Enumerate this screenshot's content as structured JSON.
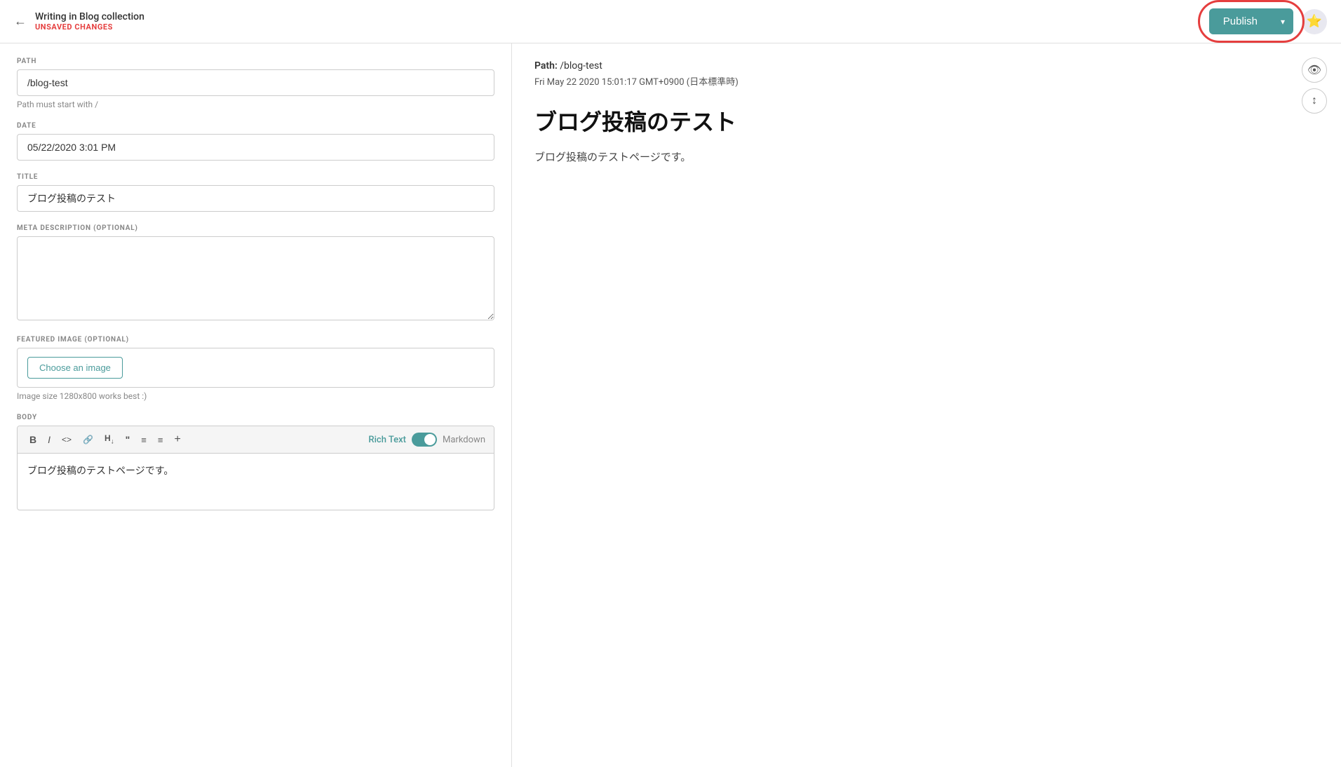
{
  "header": {
    "back_label": "←",
    "breadcrumb": "Writing in Blog collection",
    "unsaved_label": "UNSAVED CHANGES",
    "publish_label": "Publish",
    "publish_arrow": "▾"
  },
  "left": {
    "path_label": "PATH",
    "path_value": "/blog-test",
    "path_hint": "Path must start with /",
    "date_label": "DATE",
    "date_value": "05/22/2020 3:01 PM",
    "title_label": "TITLE",
    "title_value": "ブログ投稿のテスト",
    "meta_label": "META DESCRIPTION (OPTIONAL)",
    "meta_placeholder": "",
    "featured_label": "FEATURED IMAGE (OPTIONAL)",
    "choose_image_label": "Choose an image",
    "image_hint": "Image size 1280x800 works best :)",
    "body_label": "BODY",
    "toolbar": {
      "bold": "B",
      "italic": "I",
      "code": "<>",
      "link": "🔗",
      "heading": "H↓",
      "quote": "❝",
      "bullet": "≡",
      "ordered": "≡→",
      "plus": "+"
    },
    "rich_text_label": "Rich Text",
    "markdown_label": "Markdown",
    "body_content": "ブログ投稿のテストページです。"
  },
  "right": {
    "path_label": "Path:",
    "path_value": "/blog-test",
    "date_value": "Fri May 22 2020 15:01:17 GMT+0900 (日本標準時)",
    "title": "ブログ投稿のテスト",
    "body": "ブログ投稿のテストページです。"
  },
  "colors": {
    "teal": "#4a9b9b",
    "red": "#e53e3e",
    "highlight_ring": "#e53e3e"
  }
}
